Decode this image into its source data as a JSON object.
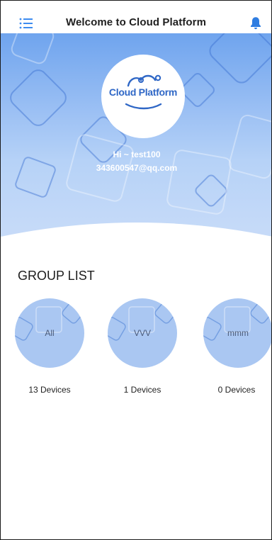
{
  "header": {
    "title": "Welcome to Cloud Platform",
    "menu_icon": "menu-list-icon",
    "notification_icon": "bell-icon",
    "accent": "#2f7de1"
  },
  "profile": {
    "logo_text": "Cloud Platform",
    "greeting": "Hi ~ test100",
    "email": "343600547@qq.com"
  },
  "groups": {
    "title": "GROUP LIST",
    "items": [
      {
        "name": "All",
        "count_label": "13 Devices"
      },
      {
        "name": "VVV",
        "count_label": "1 Devices"
      },
      {
        "name": "mmm",
        "count_label": "0 Devices"
      }
    ]
  },
  "colors": {
    "hero_top": "#6fa4ee",
    "hero_bottom": "#c9dcf8",
    "group_circle": "#aac7f2",
    "logo_text": "#2f67c6"
  }
}
